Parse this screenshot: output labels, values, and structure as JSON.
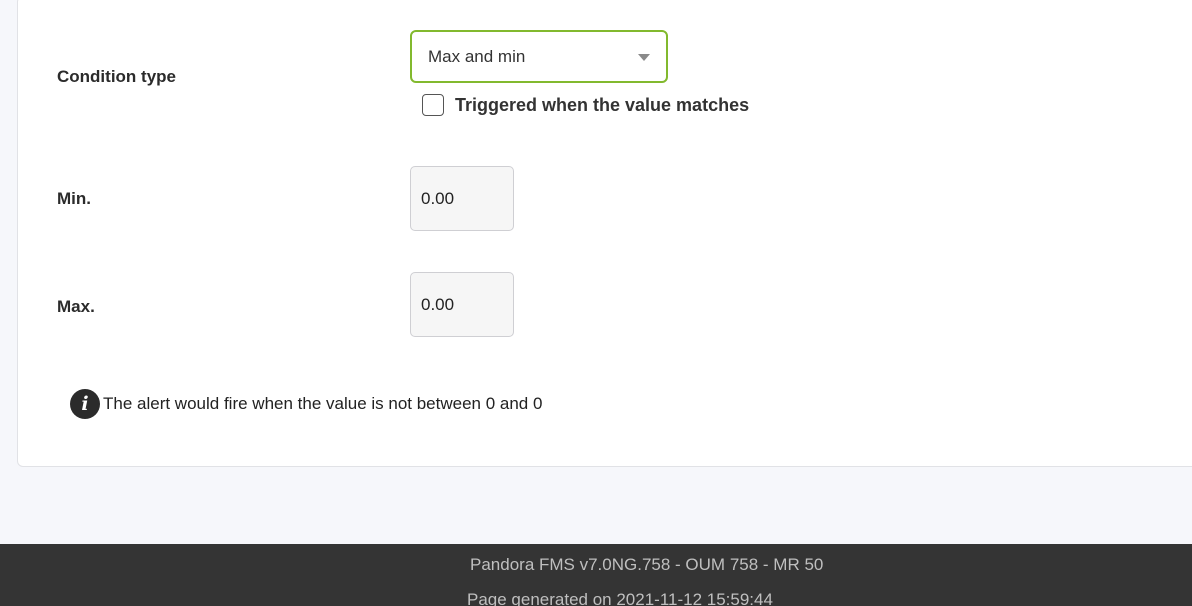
{
  "form": {
    "condition_type_label": "Condition type",
    "condition_type_value": "Max and min",
    "triggered_label": "Triggered when the value matches",
    "min_label": "Min.",
    "min_value": "0.00",
    "max_label": "Max.",
    "max_value": "0.00",
    "info_text": "The alert would fire when the value is not between 0 and 0"
  },
  "footer": {
    "version": "Pandora FMS v7.0NG.758 - OUM 758 - MR 50",
    "generated": "Page generated on 2021-11-12 15:59:44"
  },
  "icons": {
    "info": "info-icon",
    "dropdown": "chevron-down-icon"
  },
  "colors": {
    "accent": "#82b92e",
    "footer_bg": "#343434"
  }
}
